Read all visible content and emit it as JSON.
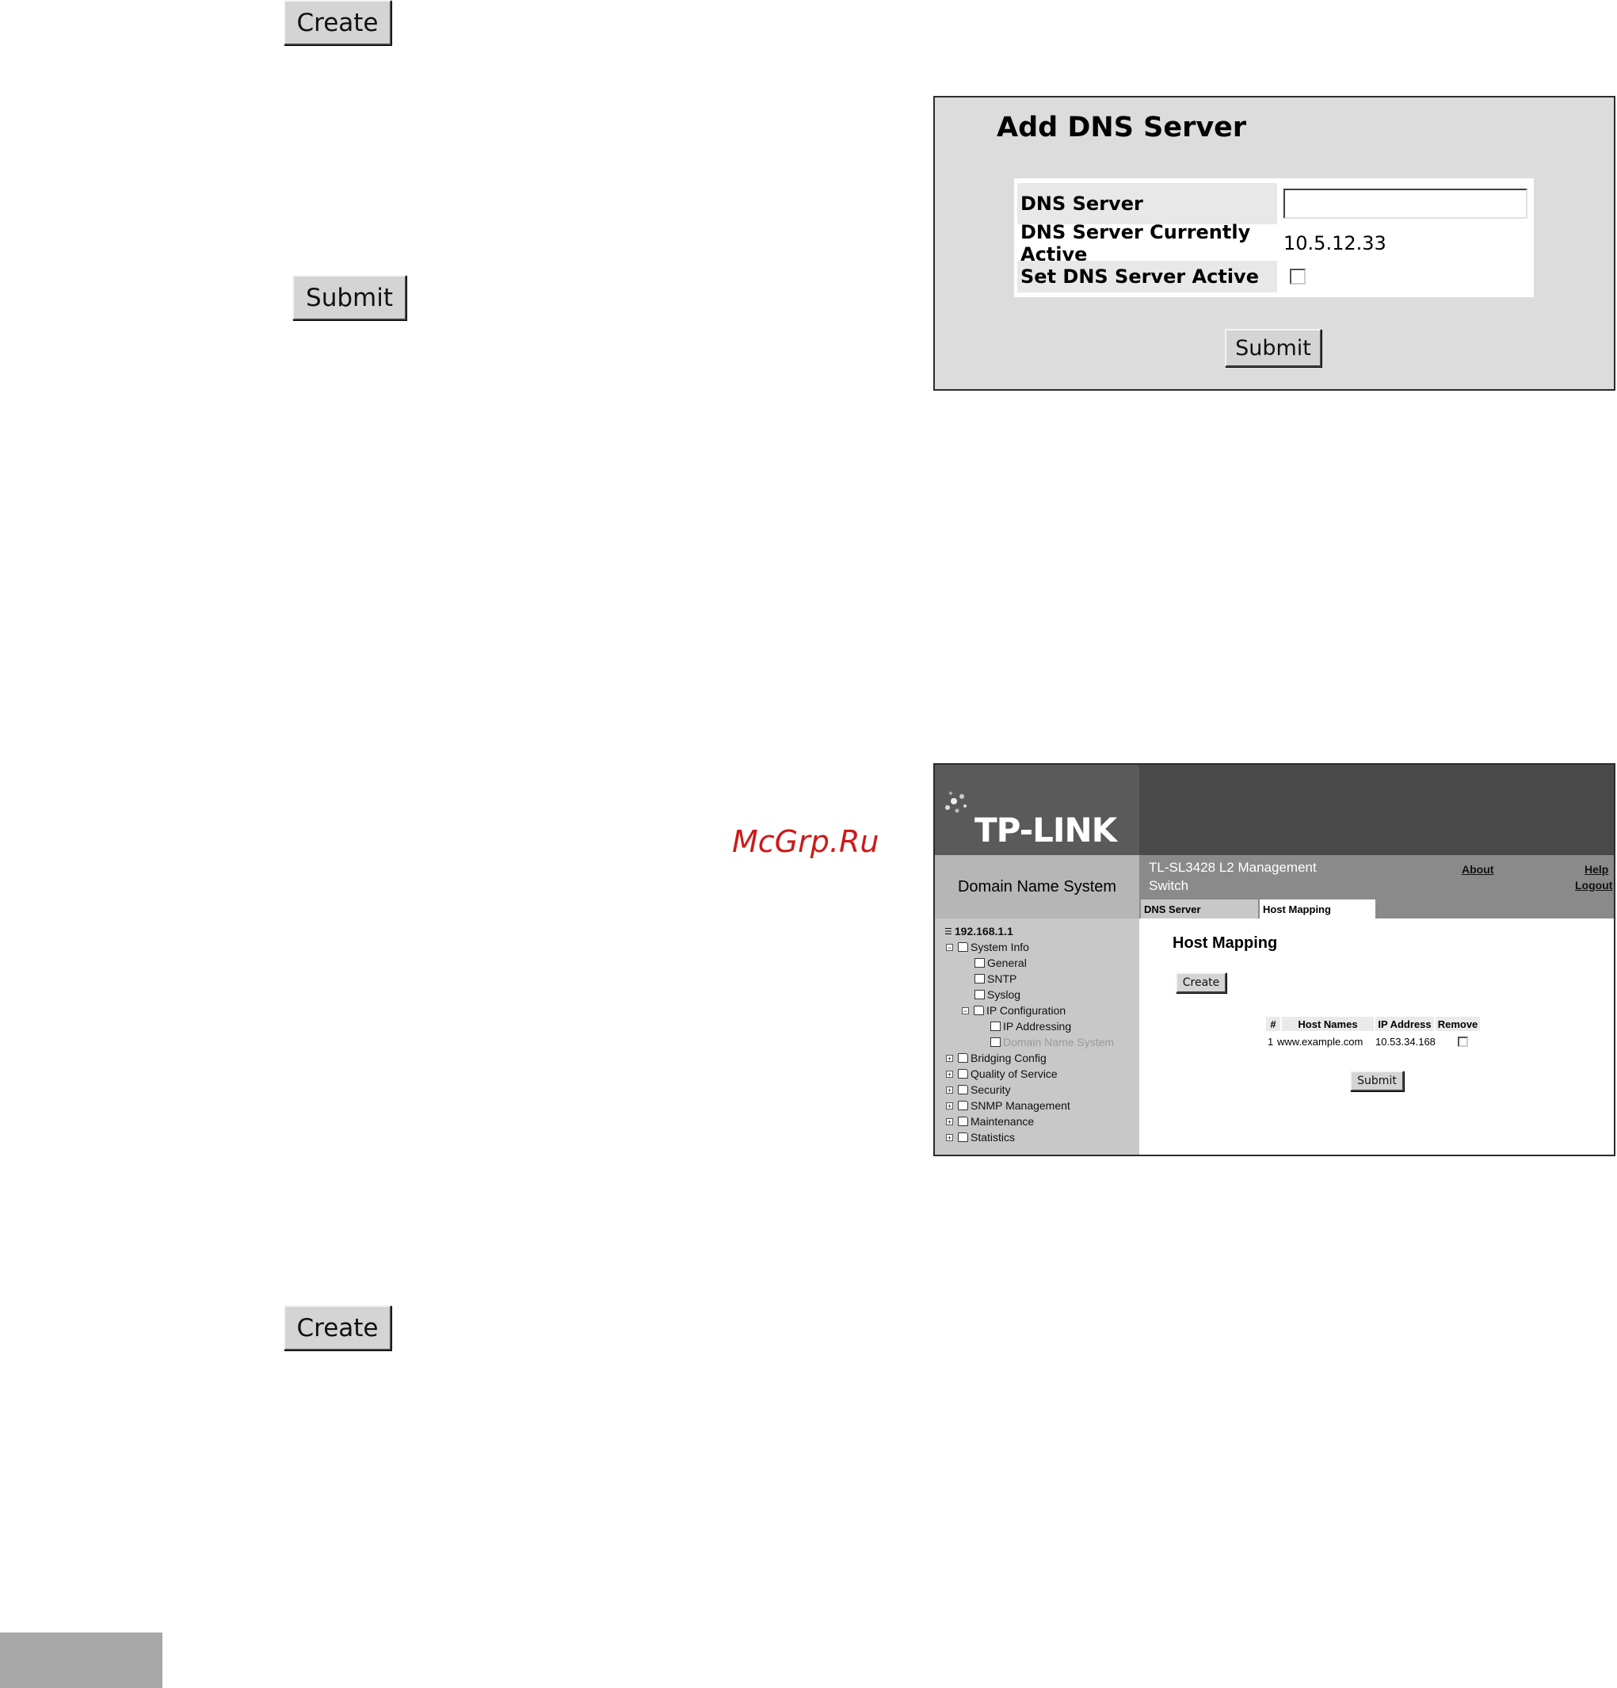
{
  "buttons": {
    "create_top": "Create",
    "submit_left": "Submit",
    "create_bottom": "Create"
  },
  "add_dns_panel": {
    "title": "Add DNS Server",
    "rows": [
      {
        "label": "DNS Server",
        "value": ""
      },
      {
        "label": "DNS Server Currently Active",
        "value": "10.5.12.33"
      },
      {
        "label": "Set DNS Server Active",
        "value": ""
      }
    ],
    "submit": "Submit"
  },
  "tplink": {
    "logo": "TP-LINK",
    "section_name": "Domain Name System",
    "product_name": "TL-SL3428 L2 Management Switch",
    "links": {
      "about": "About",
      "help": "Help",
      "logout": "Logout"
    },
    "tabs": [
      "DNS Server",
      "Host Mapping"
    ],
    "active_tab": "Host Mapping",
    "tree": {
      "root": "192.168.1.1",
      "items": [
        "System Info",
        "General",
        "SNTP",
        "Syslog",
        "IP Configuration",
        "IP Addressing",
        "Domain Name System",
        "Bridging Config",
        "Quality of Service",
        "Security",
        "SNMP Management",
        "Maintenance",
        "Statistics"
      ]
    },
    "host_mapping": {
      "title": "Host Mapping",
      "create": "Create",
      "columns": [
        "#",
        "Host Names",
        "IP Address",
        "Remove"
      ],
      "rows": [
        {
          "num": "1",
          "host": "www.example.com",
          "ip": "10.53.34.168"
        }
      ],
      "submit": "Submit"
    }
  },
  "watermark": "McGrp.Ru"
}
